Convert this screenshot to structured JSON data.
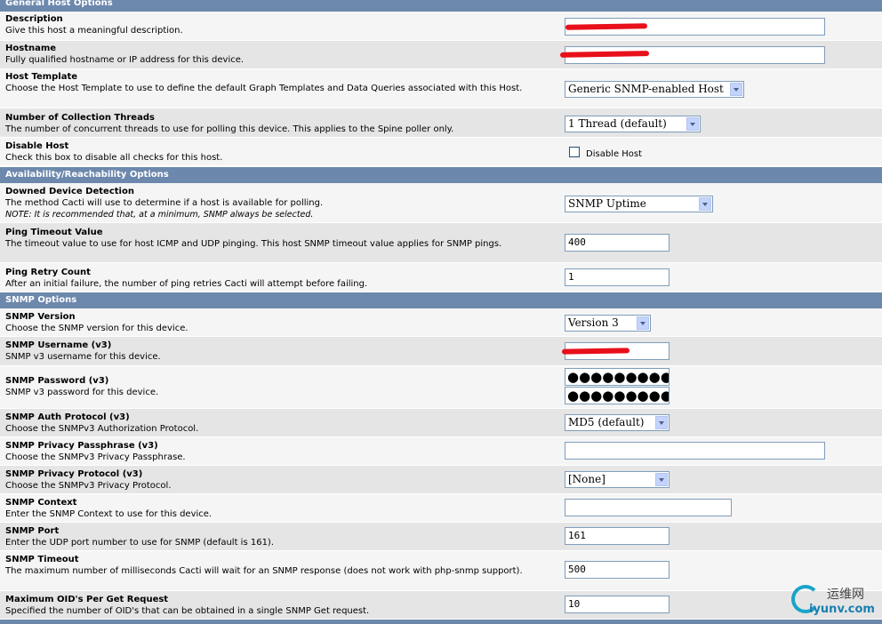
{
  "sections": {
    "general": "General Host Options",
    "availability": "Availability/Reachability Options",
    "snmp": "SNMP Options"
  },
  "fields": {
    "description": {
      "title": "Description",
      "desc": "Give this host a meaningful description."
    },
    "hostname": {
      "title": "Hostname",
      "desc": "Fully qualified hostname or IP address for this device."
    },
    "host_template": {
      "title": "Host Template",
      "desc": "Choose the Host Template to use to define the default Graph Templates and Data Queries associated with this Host.",
      "value": "Generic SNMP-enabled Host"
    },
    "threads": {
      "title": "Number of Collection Threads",
      "desc": "The number of concurrent threads to use for polling this device. This applies to the Spine poller only.",
      "value": "1 Thread (default)"
    },
    "disable_host": {
      "title": "Disable Host",
      "desc": "Check this box to disable all checks for this host.",
      "checkbox_label": "Disable Host"
    },
    "downed_detection": {
      "title": "Downed Device Detection",
      "desc": "The method Cacti will use to determine if a host is available for polling.",
      "note": "NOTE: It is recommended that, at a minimum, SNMP always be selected.",
      "value": "SNMP Uptime"
    },
    "ping_timeout": {
      "title": "Ping Timeout Value",
      "desc": "The timeout value to use for host ICMP and UDP pinging. This host SNMP timeout value applies for SNMP pings.",
      "value": "400"
    },
    "ping_retry": {
      "title": "Ping Retry Count",
      "desc": "After an initial failure, the number of ping retries Cacti will attempt before failing.",
      "value": "1"
    },
    "snmp_version": {
      "title": "SNMP Version",
      "desc": "Choose the SNMP version for this device.",
      "value": "Version 3"
    },
    "snmp_username": {
      "title": "SNMP Username (v3)",
      "desc": "SNMP v3 username for this device."
    },
    "snmp_password": {
      "title": "SNMP Password (v3)",
      "desc": "SNMP v3 password for this device.",
      "mask": "●●●●●●●●●●"
    },
    "snmp_auth": {
      "title": "SNMP Auth Protocol (v3)",
      "desc": "Choose the SNMPv3 Authorization Protocol.",
      "value": "MD5 (default)"
    },
    "snmp_priv_pass": {
      "title": "SNMP Privacy Passphrase (v3)",
      "desc": "Choose the SNMPv3 Privacy Passphrase."
    },
    "snmp_priv_proto": {
      "title": "SNMP Privacy Protocol (v3)",
      "desc": "Choose the SNMPv3 Privacy Protocol.",
      "value": "[None]"
    },
    "snmp_context": {
      "title": "SNMP Context",
      "desc": "Enter the SNMP Context to use for this device."
    },
    "snmp_port": {
      "title": "SNMP Port",
      "desc": "Enter the UDP port number to use for SNMP (default is 161).",
      "value": "161"
    },
    "snmp_timeout": {
      "title": "SNMP Timeout",
      "desc": "The maximum number of milliseconds Cacti will wait for an SNMP response (does not work with php-snmp support).",
      "value": "500"
    },
    "max_oids": {
      "title": "Maximum OID's Per Get Request",
      "desc": "Specified the number of OID's that can be obtained in a single SNMP Get request.",
      "value": "10"
    }
  },
  "watermark": {
    "cn": "运维网",
    "en": "iyunv.com"
  },
  "colors": {
    "section_bg": "#6d88ad",
    "row_light": "#f5f5f5",
    "row_dark": "#e5e5e5",
    "redaction": "#e8101a"
  }
}
